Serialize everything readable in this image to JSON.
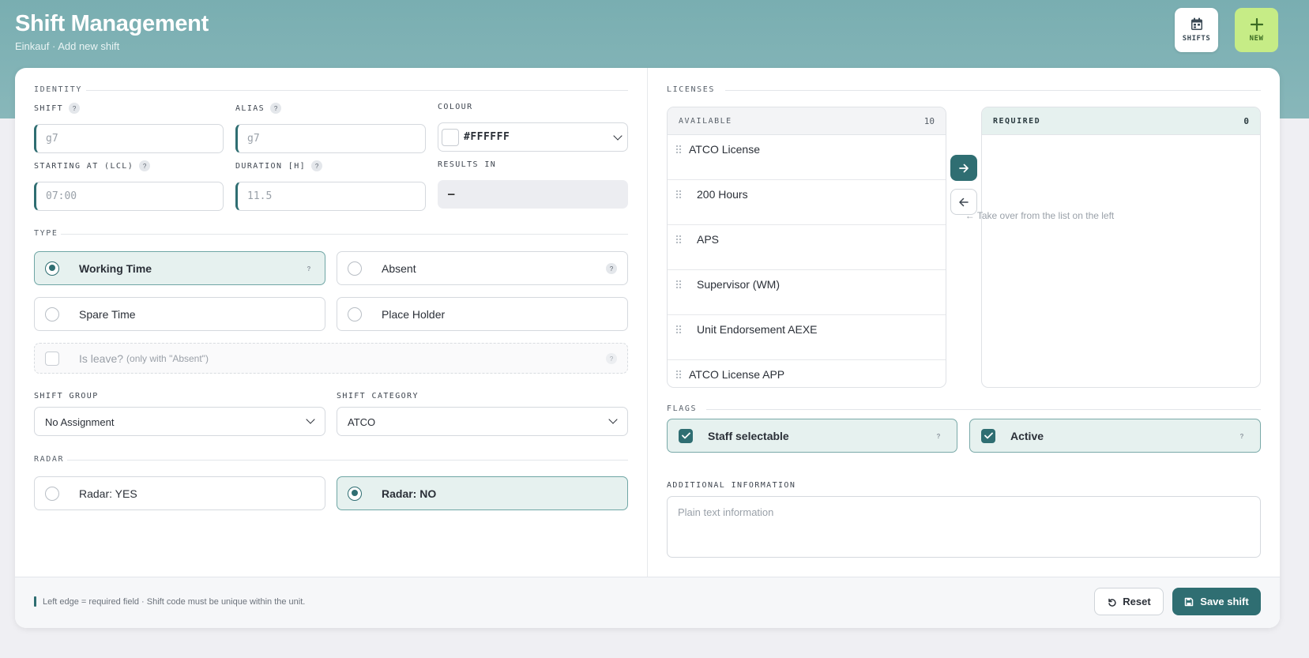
{
  "header": {
    "title": "Shift Management",
    "subtitle": "Einkauf · Add new shift",
    "shifts_button": "SHIFTS",
    "new_button": "NEW"
  },
  "identity": {
    "section": "IDENTITY",
    "shift_label": "SHIFT",
    "shift_placeholder": "g7",
    "alias_label": "ALIAS",
    "alias_placeholder": "g7",
    "colour_label": "COLOUR",
    "colour_value": "#FFFFFF",
    "start_label": "STARTING AT (LCL)",
    "start_placeholder": "07:00",
    "duration_label": "DURATION [H]",
    "duration_placeholder": "11.5",
    "results_label": "RESULTS IN",
    "results_value": "–"
  },
  "type": {
    "section": "TYPE",
    "options": [
      "Working Time",
      "Absent",
      "Spare Time",
      "Place Holder"
    ],
    "selected": "Working Time",
    "leave_label": "Is leave?",
    "leave_note": "(only with \"Absent\")"
  },
  "groups": {
    "group_label": "SHIFT GROUP",
    "group_value": "No Assignment",
    "category_label": "SHIFT CATEGORY",
    "category_value": "ATCO"
  },
  "radar": {
    "section": "RADAR",
    "options": [
      "Radar: YES",
      "Radar: NO"
    ],
    "selected": "Radar: NO"
  },
  "licenses": {
    "section": "LICENSES",
    "available_label": "AVAILABLE",
    "available_count": "10",
    "required_label": "REQUIRED",
    "required_count": "0",
    "available_items": [
      "ATCO License",
      "200 Hours",
      "APS",
      "Supervisor (WM)",
      "Unit Endorsement AEXE",
      "ATCO License APP"
    ],
    "empty_hint": "← Take over from the list on the left"
  },
  "flags": {
    "section": "FLAGS",
    "staff_selectable": "Staff selectable",
    "active": "Active"
  },
  "additional": {
    "label": "ADDITIONAL INFORMATION",
    "placeholder": "Plain text information"
  },
  "footer": {
    "note": "Left edge = required field · Shift code must be unique within the unit.",
    "reset": "Reset",
    "save": "Save shift"
  },
  "colors": {
    "accent": "#2f6e72",
    "header_bg": "#7fb2b5",
    "new_button_bg": "#c6ec86",
    "selected_bg": "#e6f1ef"
  }
}
